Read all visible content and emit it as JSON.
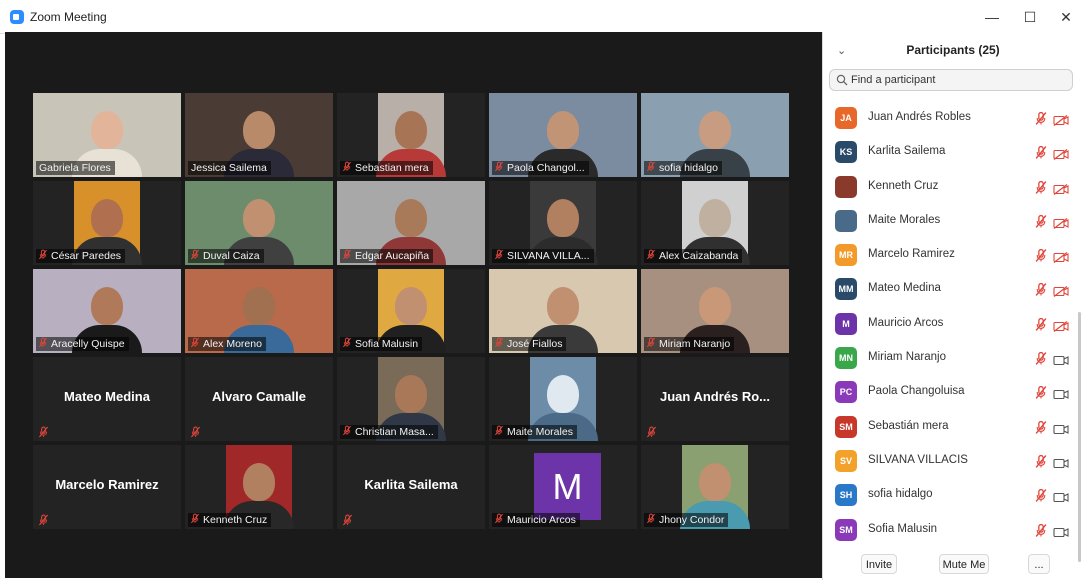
{
  "window": {
    "title": "Zoom Meeting",
    "minimize": "—",
    "maximize": "☐",
    "close": "✕"
  },
  "gallery": [
    {
      "name": "Gabriela Flores",
      "video": true,
      "muted": false,
      "active": true,
      "bg": "#c8c4b8",
      "skin": "#e2b49a",
      "shirt": "#e8e2d6"
    },
    {
      "name": "Jessica Sailema",
      "video": true,
      "muted": false,
      "bg": "#4a3c34",
      "skin": "#b88a6a",
      "shirt": "#2a2a38"
    },
    {
      "name": "Sebastian mera",
      "video": true,
      "muted": true,
      "bg": "#b8b0a8",
      "skin": "#a87456",
      "shirt": "#b83a38"
    },
    {
      "name": "Paola Changol...",
      "video": true,
      "muted": true,
      "bg": "#7c8ca0",
      "skin": "#c29476",
      "shirt": "#2a2a2a"
    },
    {
      "name": "sofia hidalgo",
      "video": true,
      "muted": true,
      "bg": "#8aa0b0",
      "skin": "#c89c80",
      "shirt": "#384048"
    },
    {
      "name": "César Paredes",
      "video": true,
      "muted": true,
      "bg": "#d8902a",
      "skin": "#b07050",
      "shirt": "#303030"
    },
    {
      "name": "Duval Caiza",
      "video": true,
      "muted": true,
      "bg": "#6c8c6c",
      "skin": "#c09070",
      "shirt": "#404040"
    },
    {
      "name": "Edgar Aucapiña",
      "video": true,
      "muted": true,
      "bg": "#a8a8a8",
      "skin": "#a87a5a",
      "shirt": "#903838"
    },
    {
      "name": "SILVANA VILLA...",
      "video": true,
      "muted": true,
      "bg": "#3a3a3a",
      "skin": "#b08060",
      "shirt": "#2c2c2c"
    },
    {
      "name": "Alex Caizabanda",
      "video": true,
      "muted": true,
      "bg": "#d0d0d0",
      "skin": "#c0b0a0",
      "shirt": "#303030"
    },
    {
      "name": "Aracelly Quispe",
      "video": true,
      "muted": true,
      "bg": "#b8b0c0",
      "skin": "#b07a5a",
      "shirt": "#1a1a1a"
    },
    {
      "name": "Alex Moreno",
      "video": true,
      "muted": true,
      "bg": "#b86a4a",
      "skin": "#a07050",
      "shirt": "#3a6a9a"
    },
    {
      "name": "Sofia Malusin",
      "video": true,
      "muted": true,
      "bg": "#e0a840",
      "skin": "#c09070",
      "shirt": "#202020"
    },
    {
      "name": "José Fiallos",
      "video": true,
      "muted": true,
      "bg": "#d8c8b0",
      "skin": "#c09070",
      "shirt": "#3a3a3a"
    },
    {
      "name": "Miriam Naranjo",
      "video": true,
      "muted": true,
      "bg": "#a89080",
      "skin": "#c89878",
      "shirt": "#2a2020"
    },
    {
      "name": "Mateo Medina",
      "video": false,
      "muted": true
    },
    {
      "name": "Alvaro Camalle",
      "video": false,
      "muted": true
    },
    {
      "name": "Christian Masa...",
      "video": true,
      "muted": true,
      "bg": "#7a6a58",
      "skin": "#a87858",
      "shirt": "#303848"
    },
    {
      "name": "Maite Morales",
      "video": true,
      "muted": true,
      "bg": "#6c8ca8",
      "skin": "#e0e8f0",
      "shirt": "#4a6a88"
    },
    {
      "name": "Juan Andrés Ro...",
      "video": false,
      "muted": true
    },
    {
      "name": "Marcelo Ramirez",
      "video": false,
      "muted": true
    },
    {
      "name": "Kenneth Cruz",
      "video": true,
      "muted": true,
      "bg": "#a02828",
      "skin": "#b08060",
      "shirt": "#282828"
    },
    {
      "name": "Karlita Sailema",
      "video": false,
      "muted": true
    },
    {
      "name": "Mauricio Arcos",
      "video": false,
      "muted": true,
      "avatar": "M"
    },
    {
      "name": "Jhony Condor",
      "video": true,
      "muted": true,
      "bg": "#8aa070",
      "skin": "#c09070",
      "shirt": "#4a9ab0"
    }
  ],
  "participants_panel": {
    "title": "Participants (25)",
    "search_placeholder": "Find a participant",
    "participants": [
      {
        "initials": "JA",
        "name": "Juan Andrés Robles",
        "color": "#e8682a",
        "video_off": true
      },
      {
        "initials": "KS",
        "name": "Karlita Sailema",
        "color": "#2a4a6a",
        "video_off": true
      },
      {
        "initials": "",
        "name": "Kenneth Cruz",
        "color": "#8a3a2a",
        "video_off": true
      },
      {
        "initials": "",
        "name": "Maite Morales",
        "color": "#4a6a8a",
        "video_off": true
      },
      {
        "initials": "MR",
        "name": "Marcelo Ramirez",
        "color": "#f29a2a",
        "video_off": true
      },
      {
        "initials": "MM",
        "name": "Mateo Medina",
        "color": "#2a4a6a",
        "video_off": true
      },
      {
        "initials": "M",
        "name": "Mauricio Arcos",
        "color": "#6c34a8",
        "video_off": true
      },
      {
        "initials": "MN",
        "name": "Miriam Naranjo",
        "color": "#3aa84a",
        "video_off": false
      },
      {
        "initials": "PC",
        "name": "Paola Changoluisa",
        "color": "#8a3ab8",
        "video_off": false
      },
      {
        "initials": "SM",
        "name": "Sebastián mera",
        "color": "#c8382a",
        "video_off": false
      },
      {
        "initials": "SV",
        "name": "SILVANA VILLACIS",
        "color": "#f2a22a",
        "video_off": false
      },
      {
        "initials": "SH",
        "name": "sofia hidalgo",
        "color": "#2a78c8",
        "video_off": false
      },
      {
        "initials": "SM",
        "name": "Sofia Malusin",
        "color": "#8a3ab8",
        "video_off": false
      }
    ],
    "footer": {
      "invite": "Invite",
      "mute_me": "Mute Me",
      "more": "..."
    }
  },
  "colors": {
    "muted_red": "#e0453a",
    "active_speaker": "#d8e850",
    "stage_bg": "#1a1a1a"
  }
}
